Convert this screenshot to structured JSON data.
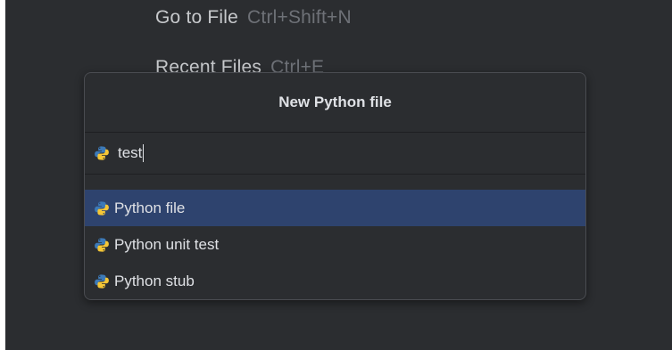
{
  "background_hints": [
    {
      "action": "Go to File",
      "shortcut": "Ctrl+Shift+N"
    },
    {
      "action": "Recent Files",
      "shortcut": "Ctrl+E"
    }
  ],
  "dialog": {
    "title": "New Python file",
    "name_input": {
      "value": "test",
      "icon": "python-icon"
    },
    "file_types": [
      {
        "label": "Python file",
        "icon": "python-icon",
        "selected": true
      },
      {
        "label": "Python unit test",
        "icon": "python-icon",
        "selected": false
      },
      {
        "label": "Python stub",
        "icon": "python-icon",
        "selected": false
      }
    ]
  },
  "colors": {
    "background": "#2b2d30",
    "selection": "#2e436e",
    "text": "#dfe1e5",
    "shortcut_text": "#6e7177",
    "python_blue": "#3d7ab8",
    "python_yellow": "#f5c636"
  }
}
